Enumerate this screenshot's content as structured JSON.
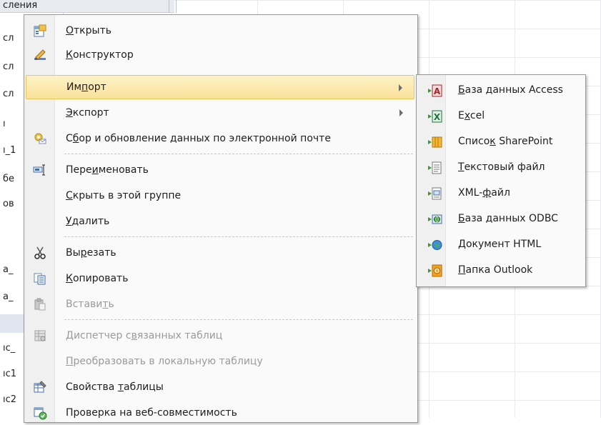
{
  "nav": {
    "header": "сления",
    "rows": [
      "сл",
      "сл",
      "сл",
      "ı",
      "ı_1",
      "бе",
      "ов",
      "",
      "а_",
      "а_",
      "",
      "ıс_",
      "ıс1",
      "ıс2"
    ]
  },
  "menu": {
    "open": {
      "pre": "",
      "u": "О",
      "post": "ткрыть",
      "icon": "open-form-icon"
    },
    "design": {
      "pre": "",
      "u": "К",
      "post": "онструктор",
      "icon": "design-view-icon"
    },
    "import": {
      "pre": "Им",
      "u": "п",
      "post": "орт"
    },
    "export": {
      "pre": "",
      "u": "Э",
      "post": "кспорт"
    },
    "collect": {
      "pre": "С",
      "u": "б",
      "post": "ор и обновление данных по электронной почте",
      "icon": "email-collect-icon"
    },
    "rename": {
      "pre": "Пере",
      "u": "и",
      "post": "меновать",
      "icon": "rename-icon"
    },
    "hide": {
      "pre": "",
      "u": "С",
      "post": "крыть в этой группе"
    },
    "delete": {
      "pre": "",
      "u": "У",
      "post": "далить"
    },
    "cut": {
      "pre": "Вы",
      "u": "р",
      "post": "езать",
      "icon": "scissors-icon"
    },
    "copy": {
      "pre": "",
      "u": "К",
      "post": "опировать",
      "icon": "copy-icon"
    },
    "paste": {
      "pre": "Встави",
      "u": "т",
      "post": "ь",
      "icon": "paste-icon"
    },
    "linked": {
      "pre": "Диспетчер с",
      "u": "в",
      "post": "язанных таблиц",
      "icon": "linked-table-icon"
    },
    "convert": {
      "pre": "",
      "u": "П",
      "post": "реобразовать в локальную таблицу"
    },
    "props": {
      "pre": "Свойства ",
      "u": "т",
      "post": "аблицы",
      "icon": "table-properties-icon"
    },
    "webcheck": {
      "pre": "Проверка на веб-совместимость",
      "u": "",
      "post": "",
      "icon": "web-compat-icon"
    }
  },
  "submenu": {
    "access": {
      "pre": "",
      "u": "Б",
      "post": "аза данных Access",
      "icon": "access-db-icon"
    },
    "excel": {
      "pre": "E",
      "u": "x",
      "post": "cel",
      "icon": "excel-icon"
    },
    "sharepoint": {
      "pre": "Списо",
      "u": "к",
      "post": " SharePoint",
      "icon": "sharepoint-list-icon"
    },
    "text": {
      "pre": "",
      "u": "Т",
      "post": "екстовый файл",
      "icon": "text-file-icon"
    },
    "xml": {
      "pre": "XML-",
      "u": "ф",
      "post": "айл",
      "icon": "xml-file-icon"
    },
    "odbc": {
      "pre": "",
      "u": "Б",
      "post": "аза данных ODBC",
      "icon": "odbc-db-icon"
    },
    "html": {
      "pre": "",
      "u": "Д",
      "post": "окумент HTML",
      "icon": "html-doc-icon"
    },
    "outlook": {
      "pre": "",
      "u": "П",
      "post": "апка Outlook",
      "icon": "outlook-folder-icon"
    }
  },
  "colors": {
    "highlight": "#fbe199",
    "disabled_text": "#9a9a9a",
    "separator": "#c8c8c8"
  }
}
